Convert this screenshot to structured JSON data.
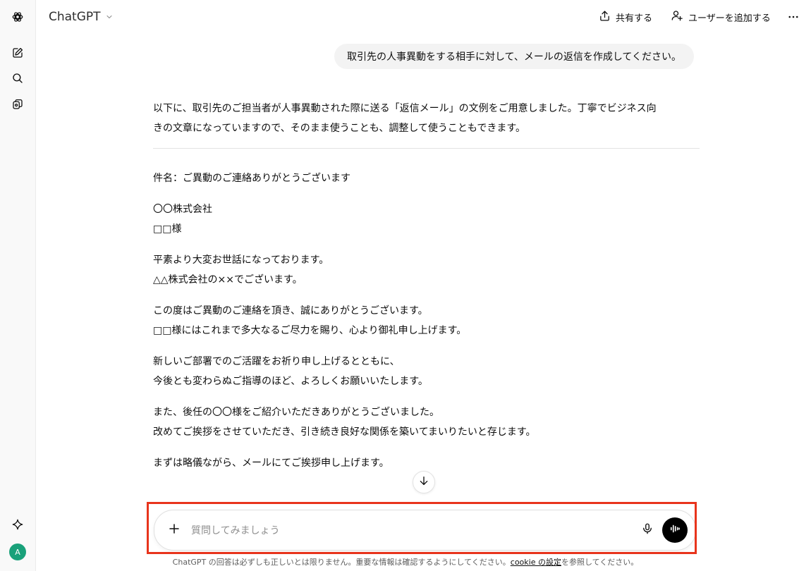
{
  "header": {
    "model_name": "ChatGPT",
    "share_label": "共有する",
    "add_user_label": "ユーザーを追加する"
  },
  "sidebar": {
    "avatar_initial": "A",
    "icons": [
      "openai-logo-icon",
      "new-chat-icon",
      "search-icon",
      "library-icon",
      "sparkle-icon"
    ]
  },
  "conversation": {
    "user_message": "取引先の人事異動をする相手に対して、メールの返信を作成してください。",
    "intro_line1": "以下に、取引先のご担当者が人事異動された際に送る「返信メール」の文例をご用意しました。丁寧でビジネス向",
    "intro_line2": "きの文章になっていますので、そのまま使うことも、調整して使うこともできます。",
    "subject_label": "件名：",
    "subject_text": "ご異動のご連絡ありがとうございます",
    "company": "〇〇株式会社",
    "recipient": "□□様",
    "greeting_line1": "平素より大変お世話になっております。",
    "greeting_line2": "△△株式会社の××でございます。",
    "body1_line1": "この度はご異動のご連絡を頂き、誠にありがとうございます。",
    "body1_line2": "□□様にはこれまで多大なるご尽力を賜り、心より御礼申し上げます。",
    "body2_line1": "新しいご部署でのご活躍をお祈り申し上げるとともに、",
    "body2_line2": "今後とも変わらぬご指導のほど、よろしくお願いいたします。",
    "body3_line1": "また、後任の〇〇様をご紹介いただきありがとうございました。",
    "body3_line2": "改めてご挨拶をさせていただき、引き続き良好な関係を築いてまいりたいと存じます。",
    "closing": "まずは略儀ながら、メールにてご挨拶申し上げます。"
  },
  "composer": {
    "placeholder": "質問してみましょう",
    "value": ""
  },
  "footer": {
    "disclaimer_before": "ChatGPT の回答は必ずしも正しいとは限りません。重要な情報は確認するようにしてください。",
    "cookie_link": "cookie の設定",
    "disclaimer_after": "を参照してください。"
  },
  "colors": {
    "highlight": "#e8341c",
    "avatar": "#19a17a",
    "user_bubble": "#f3f3f3"
  }
}
